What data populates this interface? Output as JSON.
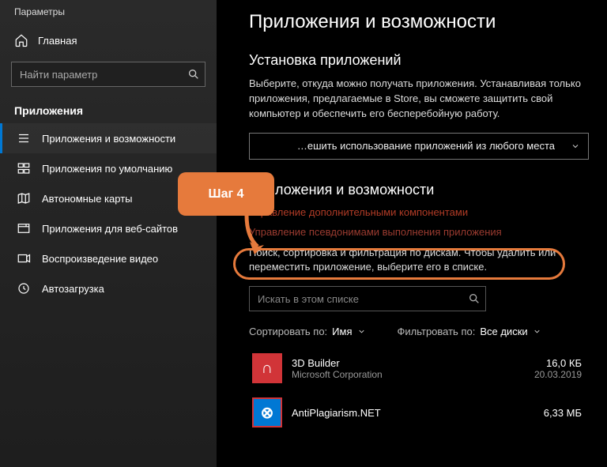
{
  "window_title": "Параметры",
  "sidebar": {
    "home_label": "Главная",
    "search_placeholder": "Найти параметр",
    "group_label": "Приложения",
    "items": [
      {
        "label": "Приложения и возможности",
        "icon": "list-icon",
        "selected": true
      },
      {
        "label": "Приложения по умолчанию",
        "icon": "default-apps-icon"
      },
      {
        "label": "Автономные карты",
        "icon": "map-icon"
      },
      {
        "label": "Приложения для веб-сайтов",
        "icon": "web-apps-icon"
      },
      {
        "label": "Воспроизведение видео",
        "icon": "video-icon"
      },
      {
        "label": "Автозагрузка",
        "icon": "startup-icon"
      }
    ]
  },
  "main": {
    "page_title": "Приложения и возможности",
    "install_section": {
      "title": "Установка приложений",
      "body": "Выберите, откуда можно получать приложения. Устанавливая только приложения, предлагаемые в Store, вы сможете защитить свой компьютер и обеспечить его бесперебойную работу.",
      "dropdown_value": "…ешить использование приложений из любого места"
    },
    "list_section": {
      "title": "Приложения и возможности",
      "link_components": "Управление дополнительными компонентами",
      "link_aliases": "Управление псевдонимами выполнения приложения",
      "body": "Поиск, сортировка и фильтрация по дискам. Чтобы удалить или переместить приложение, выберите его в списке.",
      "search_placeholder": "Искать в этом списке",
      "sort_label": "Сортировать по:",
      "sort_value": "Имя",
      "filter_label": "Фильтровать по:",
      "filter_value": "Все диски",
      "apps": [
        {
          "name": "3D Builder",
          "publisher": "Microsoft Corporation",
          "size": "16,0 КБ",
          "date": "20.03.2019",
          "icon_style": "red",
          "icon_char": "∩"
        },
        {
          "name": "AntiPlagiarism.NET",
          "publisher": "",
          "size": "6,33 МБ",
          "date": "",
          "icon_style": "blue",
          "icon_char": "⊗"
        }
      ]
    }
  },
  "callout": {
    "label": "Шаг 4",
    "color": "#e67a3c"
  }
}
